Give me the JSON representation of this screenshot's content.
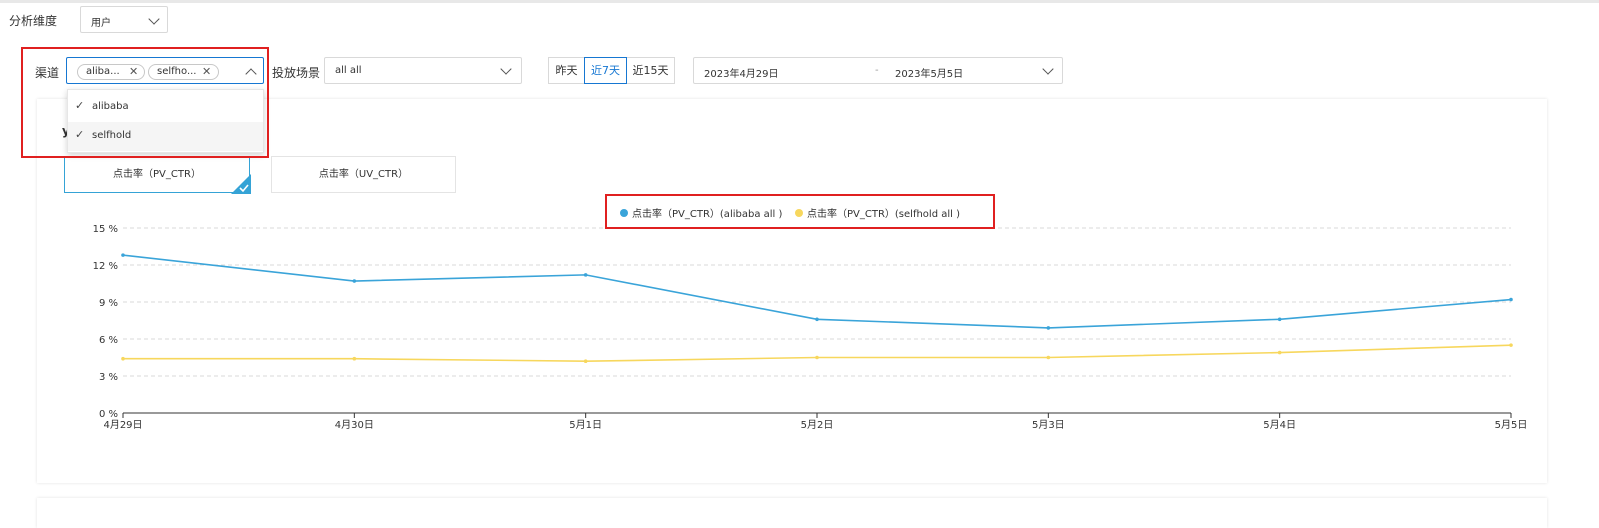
{
  "filters": {
    "dimension_label": "分析维度",
    "dimension_value": "用户",
    "channel_label": "渠道",
    "channel_tags": [
      "aliba...",
      "selfho..."
    ],
    "scene_label": "投放场景",
    "scene_value": "all all",
    "range_buttons": [
      "昨天",
      "近7天",
      "近15天"
    ],
    "active_range": "近7天",
    "date_start": "2023年4月29日",
    "date_sep": "-",
    "date_end": "2023年5月5日"
  },
  "dropdown": {
    "options": [
      "alibaba",
      "selfhold"
    ],
    "checked": [
      "alibaba",
      "selfhold"
    ],
    "check_glyph": "✓"
  },
  "metrics": {
    "items": [
      "点击率（PV_CTR）",
      "点击率（UV_CTR）"
    ],
    "selected": "点击率（PV_CTR）"
  },
  "icons": {
    "tag_remove": "close-icon",
    "select_arrow": "chevron-down-icon",
    "open_arrow": "chevron-up-icon",
    "selected_corner": "check-icon"
  },
  "colors": {
    "accent": "#1677d2",
    "series_blue": "#3aa4d9",
    "series_yellow": "#f7d75d",
    "highlight": "#e02020",
    "metric_selected": "#35a3d6"
  },
  "chart_data": {
    "type": "line",
    "x": [
      "4月29日",
      "4月30日",
      "5月1日",
      "5月2日",
      "5月3日",
      "5月4日",
      "5月5日"
    ],
    "yticks": [
      "0 %",
      "3 %",
      "6 %",
      "9 %",
      "12 %",
      "15 %"
    ],
    "ylim": [
      0,
      15
    ],
    "grid": true,
    "legend_position": "top-center",
    "series": [
      {
        "name": "点击率（PV_CTR）(alibaba all )",
        "color": "#3aa4d9",
        "values": [
          12.8,
          10.7,
          11.2,
          7.6,
          6.9,
          7.6,
          9.2
        ]
      },
      {
        "name": "点击率（PV_CTR）(selfhold all )",
        "color": "#f7d75d",
        "values": [
          4.4,
          4.4,
          4.2,
          4.5,
          4.5,
          4.9,
          5.5
        ]
      }
    ]
  }
}
